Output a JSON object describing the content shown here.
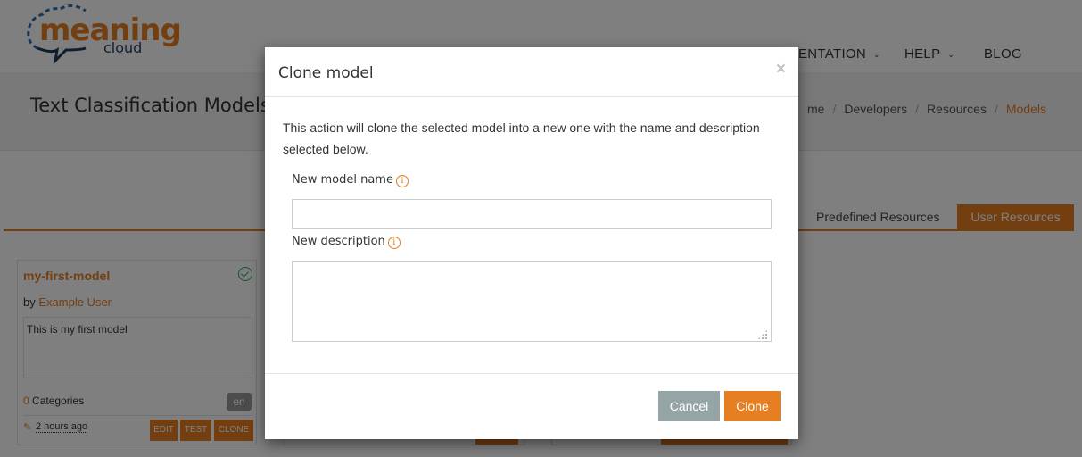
{
  "brand": {
    "logo_main": "meaning",
    "logo_sub": "cloud",
    "accent_color": "#e67e22"
  },
  "nav": {
    "items": [
      {
        "label": "DOCUMENTATION",
        "has_dropdown": true,
        "visible_text": "ENTATION"
      },
      {
        "label": "HELP",
        "has_dropdown": true
      },
      {
        "label": "BLOG",
        "has_dropdown": false
      }
    ],
    "chevron": "⌄"
  },
  "page": {
    "title": "Text Classification Models",
    "breadcrumb": [
      {
        "label": "Home",
        "visible_text": "me"
      },
      {
        "label": "Developers"
      },
      {
        "label": "Resources"
      },
      {
        "label": "Models",
        "active": true
      }
    ],
    "breadcrumb_separator": "/"
  },
  "tabs": [
    {
      "label": "Predefined Resources",
      "active": false
    },
    {
      "label": "User Resources",
      "active": true
    }
  ],
  "model_card": {
    "name": "my-first-model",
    "status_icon": "check-circle-icon",
    "by_label": "by",
    "author": "Example User",
    "description": "This is my first model",
    "categories_count": "0",
    "categories_label": "Categories",
    "language": "en",
    "edited": "2 hours ago",
    "buttons": {
      "edit": "EDIT",
      "test": "TEST",
      "clone": "CLONE"
    }
  },
  "modal": {
    "title": "Clone model",
    "close": "×",
    "description": "This action will clone the selected model into a new one with the name and description selected below.",
    "fields": {
      "name_label": "New model name",
      "name_value": "",
      "desc_label": "New description",
      "desc_value": "",
      "info_glyph": "i"
    },
    "buttons": {
      "cancel": "Cancel",
      "confirm": "Clone"
    },
    "colors": {
      "cancel": "#95a5a6",
      "confirm": "#e67e22"
    }
  }
}
